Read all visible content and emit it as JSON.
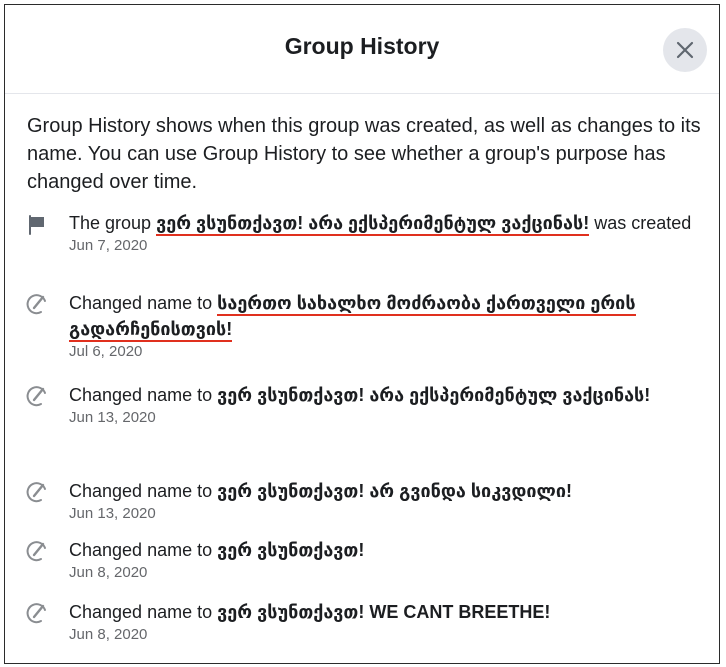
{
  "dialog": {
    "title": "Group History",
    "close_icon": "close-icon"
  },
  "description": "Group History shows when this group was created, as well as changes to its name. You can use Group History to see whether a group's purpose has changed over time.",
  "events": [
    {
      "icon": "flag-icon",
      "prefix": "The group",
      "name": "ვერ ვსუნთქავთ! არა ექსპერიმენტულ ვაქცინას!",
      "suffix": "was created",
      "date": "Jun 7, 2020"
    },
    {
      "icon": "edit-name-icon",
      "prefix": "Changed name to",
      "name": "საერთო სახალხო მოძრაობა ქართველი ერის გადარჩენისთვის!",
      "suffix": "",
      "date": "Jul 6, 2020"
    },
    {
      "icon": "edit-name-icon",
      "prefix": "Changed name to",
      "name": "ვერ ვსუნთქავთ! არა ექსპერიმენტულ ვაქცინას!",
      "suffix": "",
      "date": "Jun 13, 2020"
    },
    {
      "icon": "edit-name-icon",
      "prefix": "Changed name to",
      "name": "ვერ ვსუნთქავთ! არ გვინდა სიკვდილი!",
      "suffix": "",
      "date": "Jun 13, 2020"
    },
    {
      "icon": "edit-name-icon",
      "prefix": "Changed name to",
      "name": "ვერ ვსუნთქავთ!",
      "suffix": "",
      "date": "Jun 8, 2020"
    },
    {
      "icon": "edit-name-icon",
      "prefix": "Changed name to",
      "name": "ვერ ვსუნთქავთ! WE CANT BREETHE!",
      "suffix": "",
      "date": "Jun 8, 2020"
    }
  ],
  "colors": {
    "underline": "#e0301e",
    "date_gray": "#65676b",
    "close_bg": "#e4e6eb"
  }
}
